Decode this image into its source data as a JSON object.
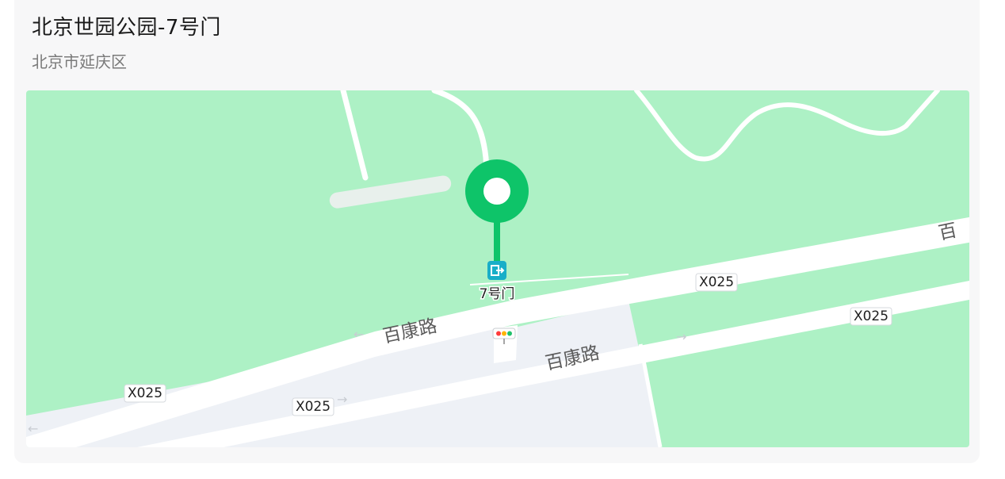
{
  "place": {
    "name": "北京世园公园-7号门",
    "address": "北京市延庆区"
  },
  "map": {
    "marker_label": "7号门",
    "marker_icon": "gate-exit-icon",
    "road_labels": [
      "百康路",
      "百康路",
      "百"
    ],
    "route_badges": [
      "X025",
      "X025",
      "X025",
      "X025"
    ],
    "traffic_light_icon": "traffic-light-icon",
    "colors": {
      "park": "#adf1c5",
      "road": "#ffffff",
      "urban": "#eef1f6",
      "marker": "#0ec469",
      "gate_icon": "#19aec8"
    }
  }
}
